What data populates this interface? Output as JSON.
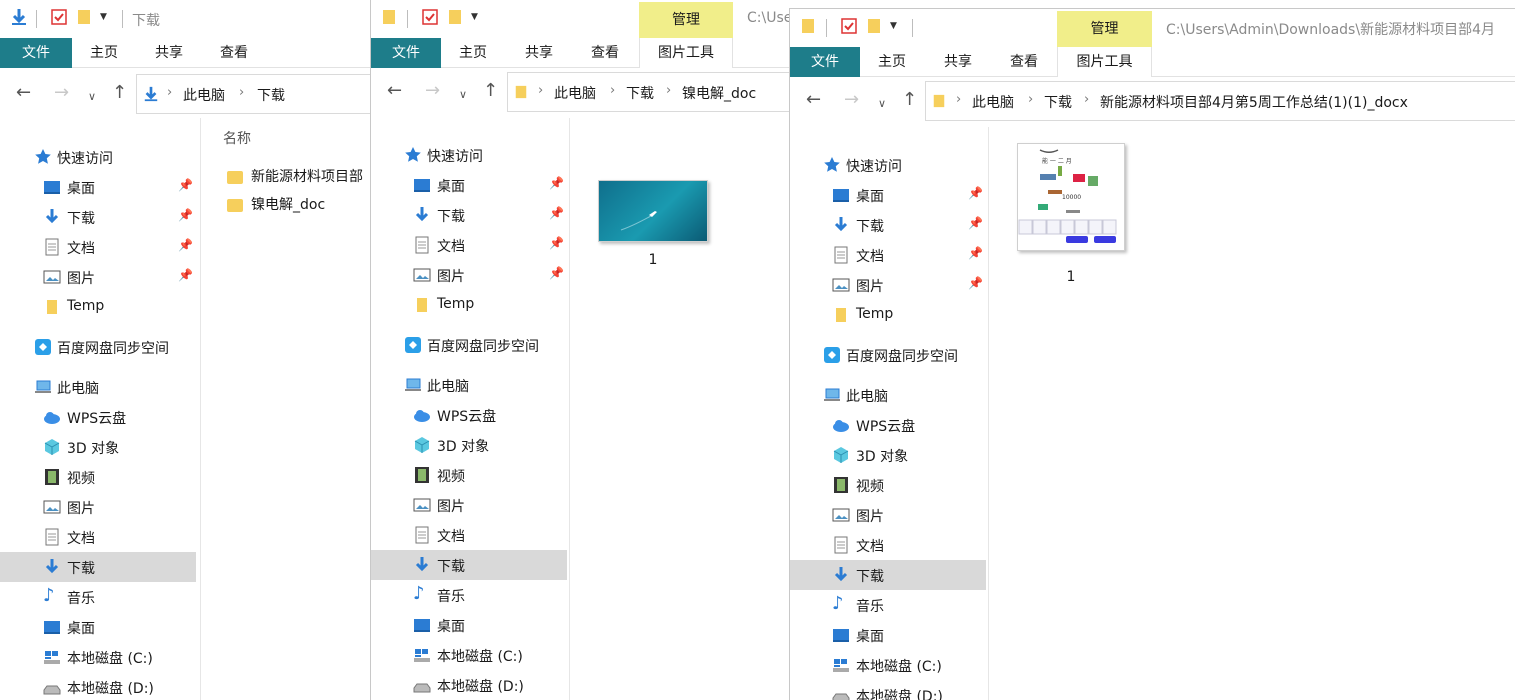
{
  "windows": [
    {
      "title": "下载",
      "tabs": [
        "文件",
        "主页",
        "共享",
        "查看"
      ],
      "breadcrumbs": [
        "此电脑",
        "下载"
      ],
      "column_header": "名称",
      "files": [
        "新能源材料项目部",
        "镍电解_doc"
      ]
    },
    {
      "title": "C:\\Use",
      "context_group": "管理",
      "context_tab": "图片工具",
      "tabs": [
        "文件",
        "主页",
        "共享",
        "查看"
      ],
      "breadcrumbs": [
        "此电脑",
        "下载",
        "镍电解_doc"
      ],
      "thumb_caption": "1"
    },
    {
      "title": "C:\\Users\\Admin\\Downloads\\新能源材料项目部4月",
      "context_group": "管理",
      "context_tab": "图片工具",
      "tabs": [
        "文件",
        "主页",
        "共享",
        "查看"
      ],
      "breadcrumbs": [
        "此电脑",
        "下载",
        "新能源材料项目部4月第5周工作总结(1)(1)_docx"
      ],
      "thumb_caption": "1",
      "thumb_text": {
        "line1": "能 一 二 月",
        "amount": "10000"
      }
    }
  ],
  "sidebar": {
    "quick_access": "快速访问",
    "pinned": [
      "桌面",
      "下载",
      "文档",
      "图片"
    ],
    "temp": "Temp",
    "baidu": "百度网盘同步空间",
    "this_pc": "此电脑",
    "pc_items": [
      "WPS云盘",
      "3D 对象",
      "视频",
      "图片",
      "文档",
      "下载",
      "音乐",
      "桌面",
      "本地磁盘 (C:)",
      "本地磁盘 (D:)"
    ]
  },
  "colors": {
    "file_tab": "#1e7d8a",
    "context": "#f1ee8a",
    "selected": "#d9d9d9",
    "folder": "#f6cf5c",
    "arrow": "#2b7cd3"
  }
}
